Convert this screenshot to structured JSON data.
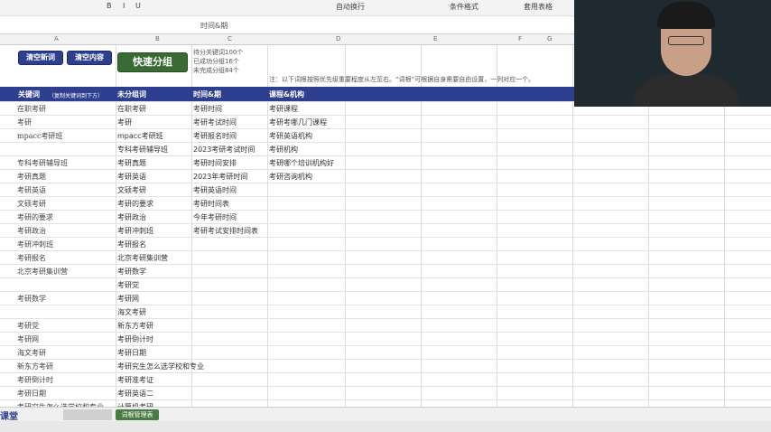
{
  "ribbon": {
    "items": [
      "B",
      "I",
      "U",
      "自动换行",
      "条件格式",
      "套用表格"
    ]
  },
  "formula_bar": {
    "content": "时间&期"
  },
  "columns": [
    "A",
    "B",
    "C",
    "D",
    "E",
    "F",
    "G",
    "H"
  ],
  "buttons": {
    "clear_new": "清空新词",
    "clear_content": "清空内容",
    "quick_group": "快速分组"
  },
  "stats": [
    "待分关键词100个",
    "已成功分组16个",
    "未完成分组84个"
  ],
  "note": "注：以下词根按照优先级重要程度从左至右。“词根”可根据自身需要自由设置，一列对应一个。",
  "header": {
    "keyword": "关键词",
    "keyword_hint": "（复制关键词到下方）",
    "ungrouped": "未分组词",
    "time_period": "时间&期",
    "course_org": "课程&机构"
  },
  "keywords": [
    "在职考研",
    "考研",
    "mpacc考研班",
    "",
    "专科考研辅导班",
    "考研真题",
    "考研英语",
    "文硕考研",
    "考研的要求",
    "考研政治",
    "考研冲刺班",
    "考研报名",
    "北京考研集训营",
    "",
    "考研数学",
    "",
    "考研党",
    "考研网",
    "海文考研",
    "新东方考研",
    "考研倒计时",
    "考研日期",
    "考研究生怎么选学校和专业"
  ],
  "ungrouped": [
    "在职考研",
    "考研",
    "mpacc考研班",
    "专科考研辅导班",
    "考研真题",
    "考研英语",
    "文硕考研",
    "考研的要求",
    "考研政治",
    "考研冲刺班",
    "考研报名",
    "北京考研集训营",
    "考研数学",
    "考研党",
    "考研网",
    "海文考研",
    "新东方考研",
    "考研倒计时",
    "考研日期",
    "考研究生怎么选学校和专业",
    "考研准考证",
    "考研英语二",
    "计算机考研"
  ],
  "time_period": [
    "考研时间",
    "考研考试时间",
    "考研报名时间",
    "2023考研考试时间",
    "考研时间安排",
    "2023年考研时间",
    "考研英语时间",
    "考研时间表",
    "今年考研时间",
    "考研考试安排时间表"
  ],
  "course_org": [
    "考研课程",
    "考研考哪几门课程",
    "考研英语机构",
    "考研机构",
    "考研哪个培训机构好",
    "考研咨询机构"
  ],
  "sheet_tab": "词根管理表",
  "logo": "课堂"
}
